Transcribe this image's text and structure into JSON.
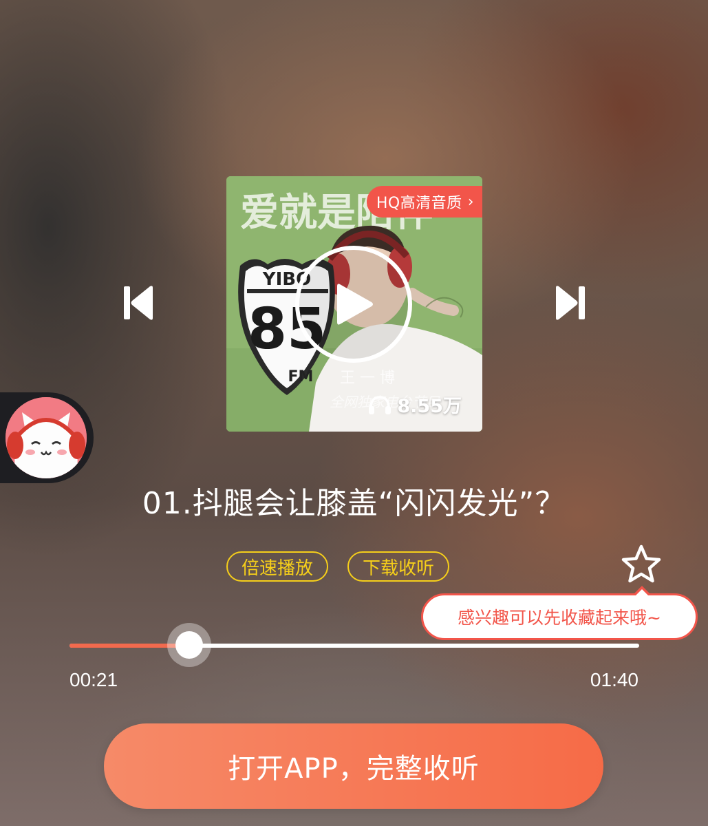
{
  "cover": {
    "hq_badge": "HQ高清音质",
    "hq_chevron": "›",
    "play_count": "8.55万",
    "art_text": {
      "banner": "爱就是陪伴",
      "sign_top": "YIBO",
      "sign_number": "85",
      "sign_bottom": "FM",
      "host_name": "王 一 博",
      "subtitle": "全网独家电台节目"
    }
  },
  "track": {
    "title": "01.抖腿会让膝盖“闪闪发光”？"
  },
  "chips": [
    {
      "label": "倍速播放"
    },
    {
      "label": "下载收听"
    }
  ],
  "tooltip": {
    "text": "感兴趣可以先收藏起来哦~"
  },
  "player": {
    "current_time": "00:21",
    "total_time": "01:40",
    "progress": 0.21
  },
  "cta": {
    "label": "打开APP，完整收听"
  },
  "colors": {
    "accent": "#f2554a",
    "chip": "#f6cf1a",
    "cta_start": "#f68a68",
    "cta_end": "#f66b47",
    "cover_bg": "#8fb56f"
  },
  "icons": {
    "previous": "skip-previous-icon",
    "next": "skip-next-icon",
    "play": "play-icon",
    "headphones": "headphones-icon",
    "favorite": "star-icon",
    "mascot": "cat-mascot-icon"
  }
}
